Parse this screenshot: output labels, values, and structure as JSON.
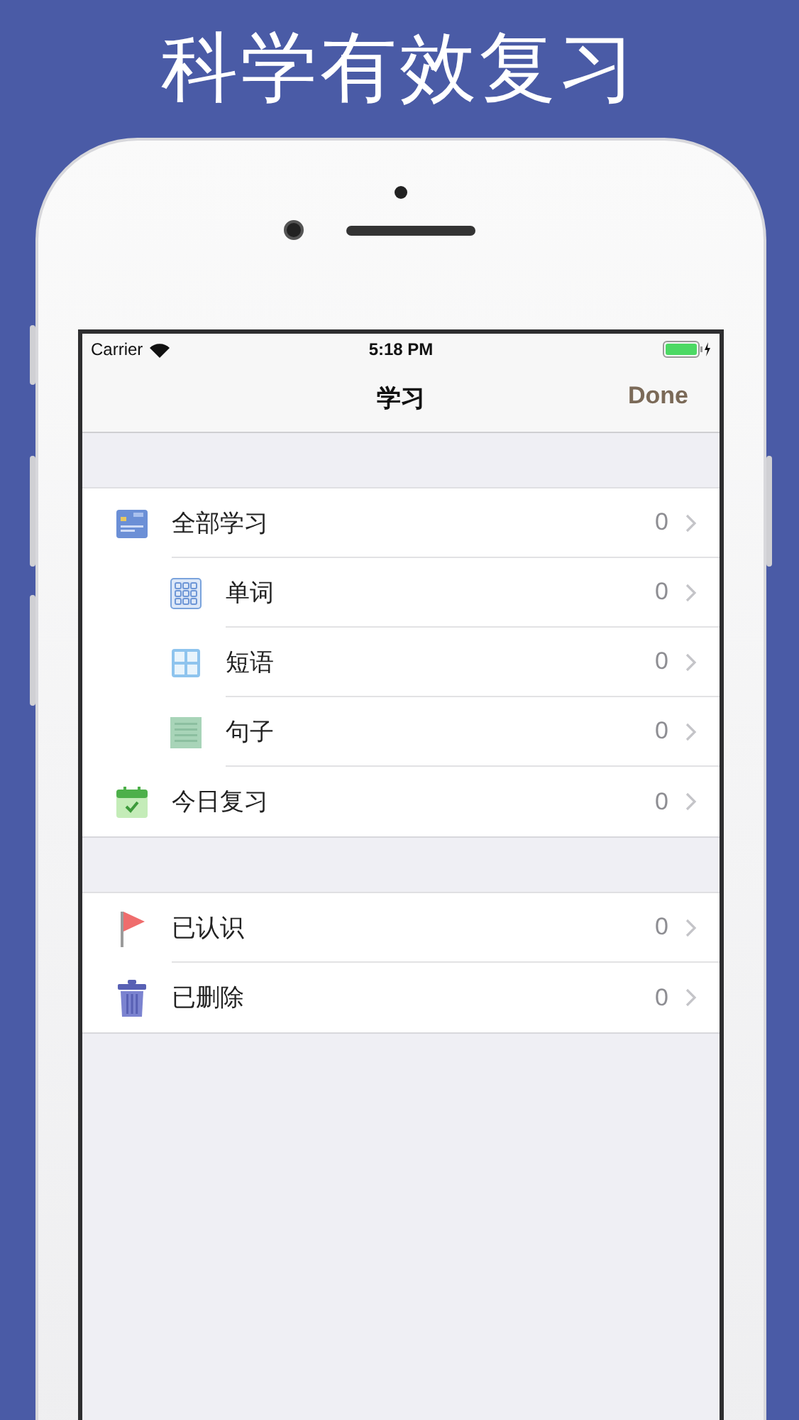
{
  "headline": "科学有效复习",
  "status_bar": {
    "carrier": "Carrier",
    "time": "5:18 PM"
  },
  "nav_bar": {
    "title": "学习",
    "done": "Done"
  },
  "sections": [
    {
      "items": [
        {
          "label": "全部学习",
          "count": "0",
          "children": [
            {
              "label": "单词",
              "count": "0"
            },
            {
              "label": "短语",
              "count": "0"
            },
            {
              "label": "句子",
              "count": "0"
            }
          ]
        },
        {
          "label": "今日复习",
          "count": "0"
        }
      ]
    },
    {
      "items": [
        {
          "label": "已认识",
          "count": "0"
        },
        {
          "label": "已删除",
          "count": "0"
        }
      ]
    }
  ]
}
